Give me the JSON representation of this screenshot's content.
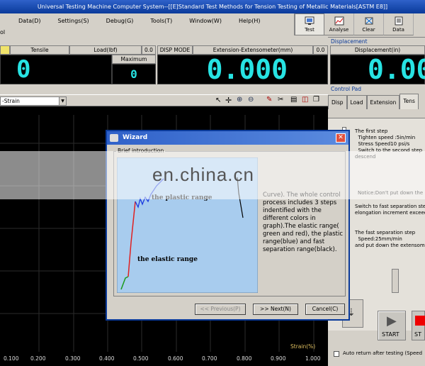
{
  "window": {
    "title": "Universal Testing Machine Computer System--[[E]Standard Test Methods for Tension Testing of Metallic Materials[ASTM E8]]"
  },
  "menu": {
    "items": [
      "Data(D)",
      "Settings(S)",
      "Debug(G)",
      "Tools(T)",
      "Window(W)",
      "Help(H)"
    ],
    "left_fragment": "ol"
  },
  "toolbar": {
    "buttons": [
      {
        "label": "Test",
        "icon": "test-icon"
      },
      {
        "label": "Analyse",
        "icon": "analyse-icon"
      },
      {
        "label": "Clear",
        "icon": "clear-icon"
      },
      {
        "label": "Data",
        "icon": "data-icon"
      }
    ]
  },
  "readouts": {
    "tensile_label": "Tensile",
    "load_label": "Load(lbf)",
    "load_small": "0.0",
    "load_value": "0",
    "maximum_label": "Maximum",
    "maximum_value": "0",
    "disp_mode_label": "DISP MODE",
    "extension_label": "Extension-Extensometer(mm)",
    "extension_small": "0.0",
    "extension_value": "0.000",
    "displacement_header": "Displacement",
    "displacement_label": "Displacement(in)",
    "displacement_value": "0.00"
  },
  "chart": {
    "curve_select": "-Strain",
    "x_axis_label": "Strain(%)",
    "x_ticks": [
      "0.100",
      "0.200",
      "0.300",
      "0.400",
      "0.500",
      "0.600",
      "0.700",
      "0.800",
      "0.900",
      "1.000"
    ]
  },
  "wizard": {
    "title": "Wizard",
    "group_label": "Brief introduction",
    "plastic_label": "the plastic range",
    "elastic_label": "the elastic range",
    "description": "Curve). The whole control process includes 3 steps indentified with the different colors in graph).The elastic range( green and red), the plastic range(blue) and fast separation range(black).",
    "prev_label": "<< Previous(P)",
    "next_label": ">> Next(N)",
    "cancel_label": "Cancel(C)"
  },
  "control_pad": {
    "header": "Control Pad",
    "tabs": [
      "Disp",
      "Load",
      "Extension",
      "Tens"
    ],
    "step1": "The first step\n  Tighten speed :5in/min\n  Stress Speed10 psi/s\n  Switch to the second step\ndescend",
    "notice": "Notice:Don't put down the",
    "switch_text": "Switch to fast separation step\nelongation increment exceed",
    "fast_step": "The fast separation step\n  Speed:25mm/min\nand put down the extensom",
    "start_label": "START",
    "stop_label": "ST",
    "auto_return": "Auto return after testing (Speed"
  },
  "watermark": {
    "text": "en.china.cn"
  },
  "colors": {
    "lcd": "#27e3e3",
    "title_bar": "#0a3a9a",
    "elastic_green": "#1a9a1a",
    "elastic_red": "#e02020",
    "plastic_blue": "#1a3ae0"
  }
}
